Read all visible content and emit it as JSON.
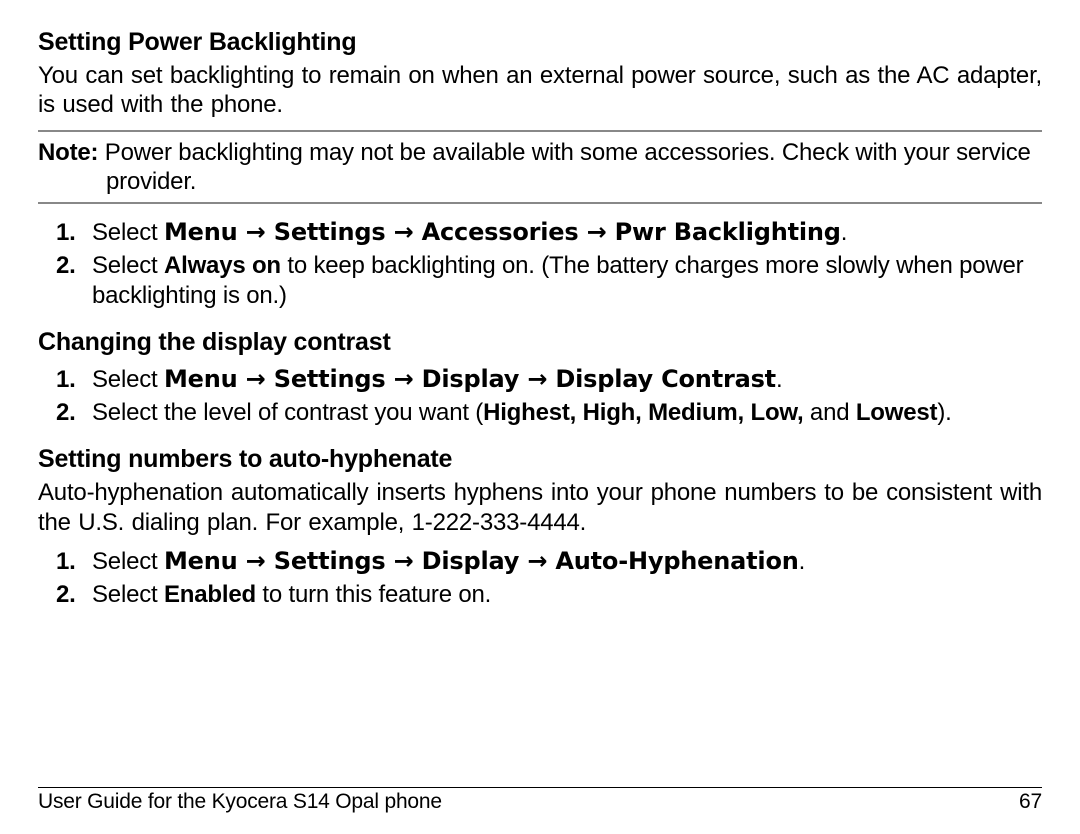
{
  "sec1": {
    "heading": "Setting Power Backlighting",
    "para": "You can set backlighting to remain on when an external power source, such as the AC adapter, is used with the phone.",
    "note_label": "Note:",
    "note_text": " Power backlighting may not be available with some accessories. Check with your service provider.",
    "step1_before": "Select ",
    "step1_path": "Menu → Settings → Accessories → Pwr Backlighting",
    "step1_after": ".",
    "step2_before": "Select ",
    "step2_bold": "Always on",
    "step2_after": " to keep backlighting on. (The battery charges more slowly when power backlighting is on.)"
  },
  "sec2": {
    "heading": "Changing the display contrast",
    "step1_before": "Select ",
    "step1_path": "Menu → Settings → Display → Display Contrast",
    "step1_after": ".",
    "step2_before": "Select the level of contrast you want (",
    "step2_bold": "Highest, High, Medium, Low,",
    "step2_mid": " and ",
    "step2_bold2": "Lowest",
    "step2_after": ")."
  },
  "sec3": {
    "heading": "Setting numbers to auto-hyphenate",
    "para": "Auto-hyphenation automatically inserts hyphens into your phone numbers to be consistent with the U.S. dialing plan. For example, 1-222-333-4444.",
    "step1_before": "Select ",
    "step1_path": "Menu → Settings → Display → Auto-Hyphenation",
    "step1_after": ".",
    "step2_before": "Select ",
    "step2_bold": "Enabled",
    "step2_after": " to turn this feature on."
  },
  "footer": {
    "title": "User Guide for the Kyocera S14 Opal phone",
    "page": "67"
  }
}
